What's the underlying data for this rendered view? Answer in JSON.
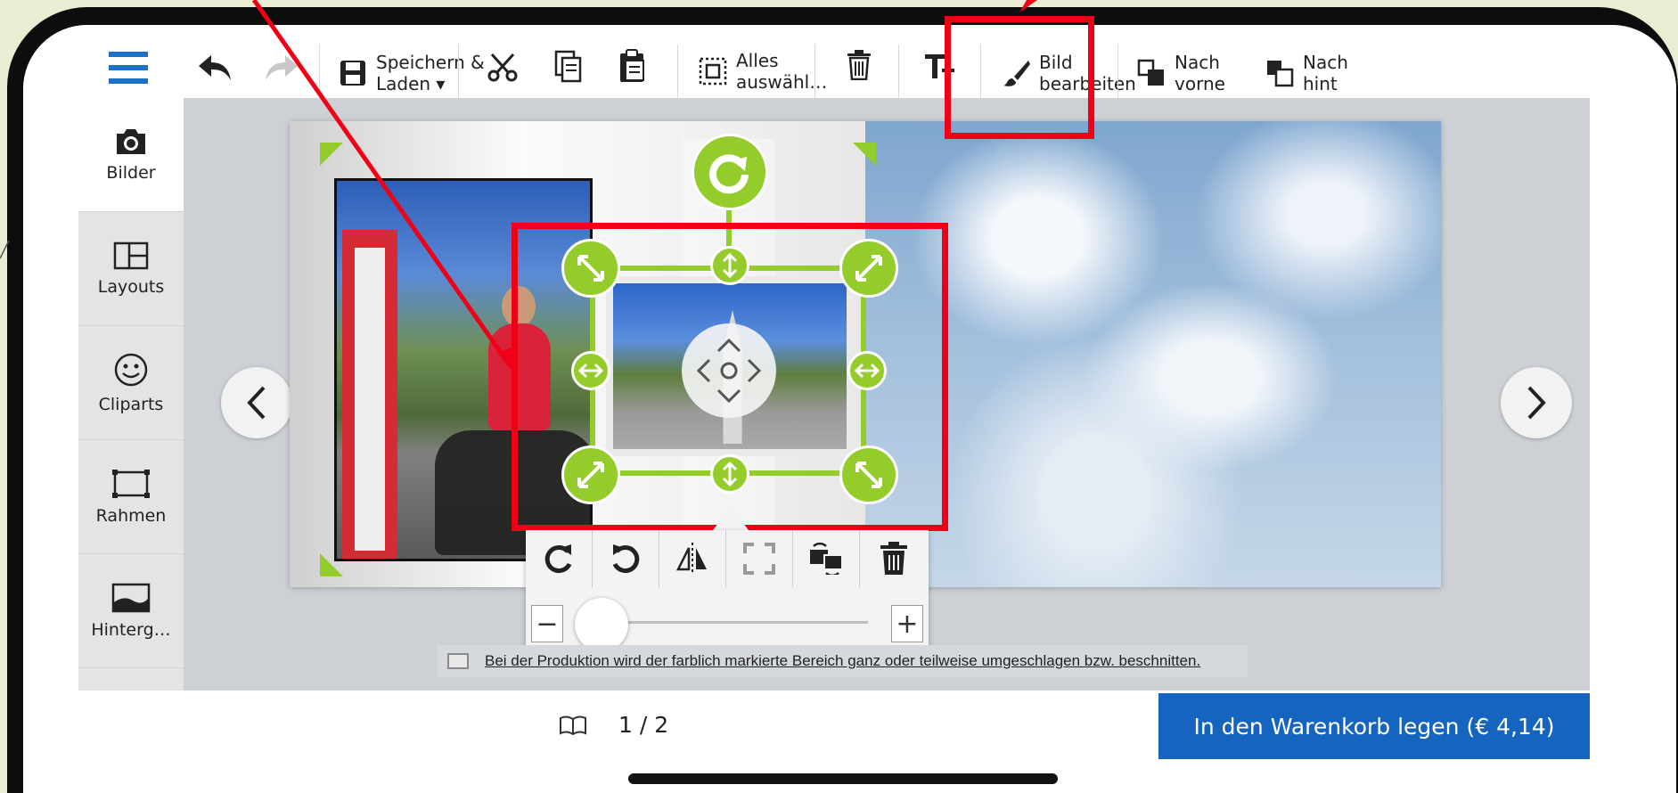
{
  "toolbar": {
    "save_label": "Speichern &\nLaden ▾",
    "select_all_label": "Alles\nauswähl…",
    "edit_image_label": "Bild\nbearbeiten",
    "bring_front_label": "Nach\nvorne",
    "send_back_label": "Nach\nhint"
  },
  "sidebar": {
    "items": [
      {
        "label": "Bilder",
        "icon": "camera-icon"
      },
      {
        "label": "Layouts",
        "icon": "layout-icon"
      },
      {
        "label": "Cliparts",
        "icon": "smiley-icon"
      },
      {
        "label": "Rahmen",
        "icon": "frame-icon"
      },
      {
        "label": "Hinterg…",
        "icon": "background-icon"
      }
    ]
  },
  "notice": {
    "text": "Bei der Produktion wird der farblich markierte Bereich ganz oder teilweise umgeschlagen bzw. beschnitten."
  },
  "footer": {
    "page_indicator": "1 / 2",
    "cart_button": "In den Warenkorb legen (€ 4,14)"
  },
  "colors": {
    "accent_green": "#93cc2b",
    "highlight_red": "#f00016",
    "cart_blue": "#1565c0",
    "menu_blue": "#1a73c8"
  }
}
